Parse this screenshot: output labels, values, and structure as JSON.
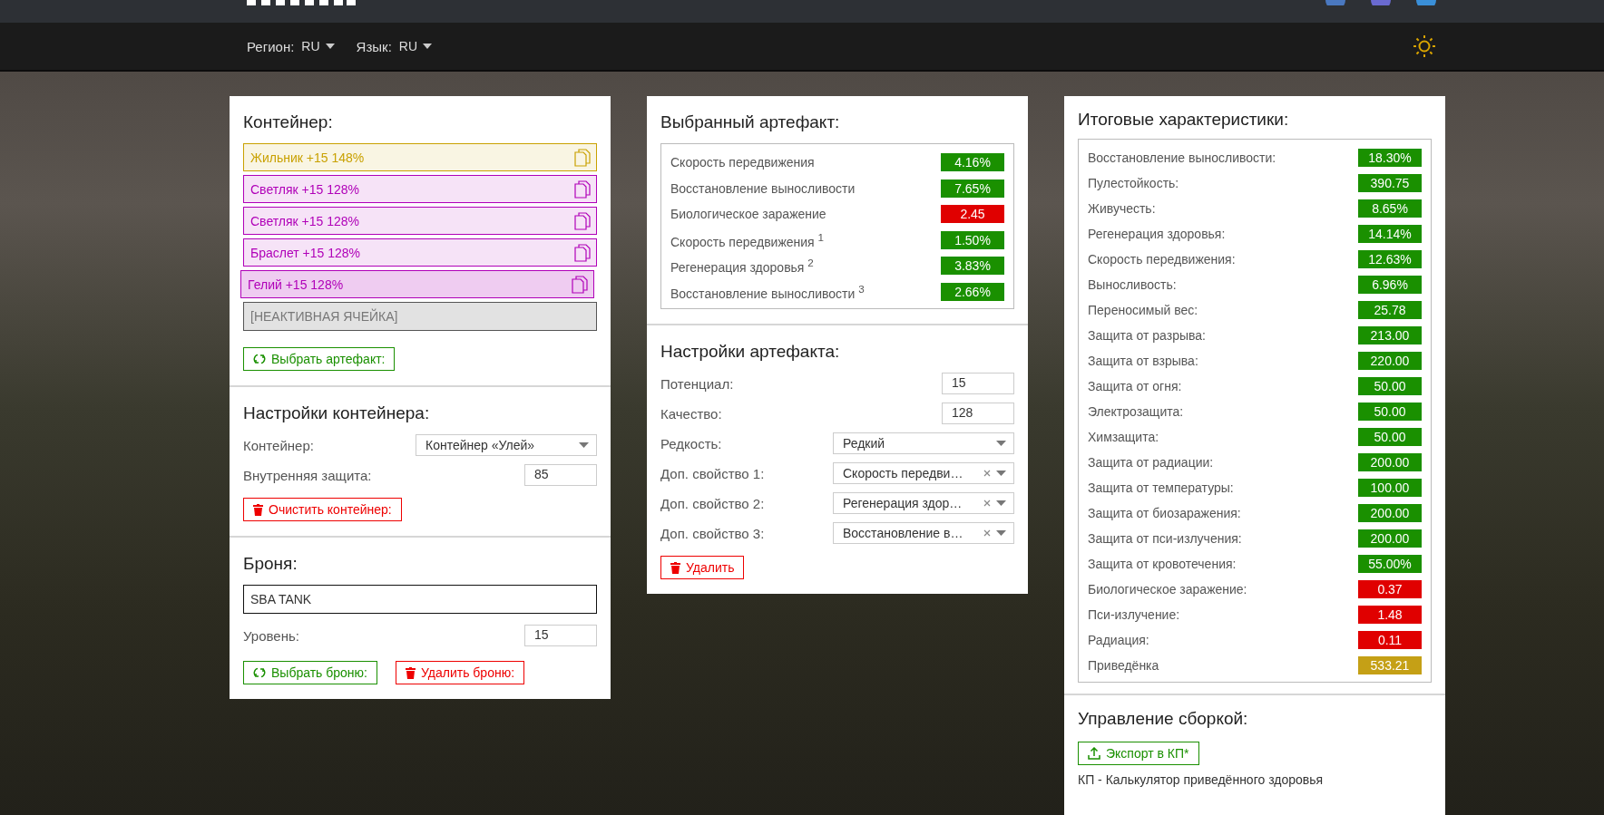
{
  "nav": {
    "region": {
      "label": "Регион:",
      "value": "RU"
    },
    "language": {
      "label": "Язык:",
      "value": "RU"
    }
  },
  "container": {
    "title": "Контейнер:",
    "cells": [
      {
        "kind": "artifact",
        "label": "Жильник +15 148%",
        "color": "#c9a100",
        "selected": false
      },
      {
        "kind": "artifact",
        "label": "Светляк +15 128%",
        "color": "#b000b8",
        "selected": false
      },
      {
        "kind": "artifact",
        "label": "Светляк +15 128%",
        "color": "#b000b8",
        "selected": false
      },
      {
        "kind": "artifact",
        "label": "Браслет +15 128%",
        "color": "#b000b8",
        "selected": false
      },
      {
        "kind": "artifact",
        "label": "Гелий +15 128%",
        "color": "#b000b8",
        "selected": true
      },
      {
        "kind": "inactive",
        "label": "[НЕАКТИВНАЯ ЯЧЕЙКА]",
        "color": "#555555",
        "selected": false
      }
    ],
    "select_button": "Выбрать артефакт:"
  },
  "container_settings": {
    "title": "Настройки контейнера:",
    "fields": [
      {
        "kind": "select",
        "label": "Контейнер:",
        "value": "Контейнер «Улей»",
        "clearable": false
      },
      {
        "kind": "input",
        "label": "Внутренняя защита:",
        "value": "85"
      }
    ],
    "clear_button": "Очистить контейнер:"
  },
  "armor": {
    "title": "Броня:",
    "name": "SBA TANK",
    "fields": [
      {
        "kind": "input",
        "label": "Уровень:",
        "value": "15"
      }
    ],
    "select_button": "Выбрать броню:",
    "delete_button": "Удалить броню:"
  },
  "selected_artifact": {
    "title": "Выбранный артефакт:",
    "stats": [
      {
        "label": "Скорость передвижения",
        "value": "4.16%",
        "color": "#1a9000"
      },
      {
        "label": "Восстановление выносливости",
        "value": "7.65%",
        "color": "#1a9000"
      },
      {
        "label": "Биологическое заражение",
        "value": "2.45",
        "color": "#e00000"
      },
      {
        "label": "Скорость передвижения $^{1}$",
        "value": "1.50%",
        "color": "#1a9000"
      },
      {
        "label": "Регенерация здоровья $^{2}$",
        "value": "3.83%",
        "color": "#1a9000"
      },
      {
        "label": "Восстановление выносливости $^{3}$",
        "value": "2.66%",
        "color": "#1a9000"
      }
    ]
  },
  "artifact_settings": {
    "title": "Настройки артефакта:",
    "fields": [
      {
        "kind": "input",
        "label": "Потенциал:",
        "value": "15"
      },
      {
        "kind": "input",
        "label": "Качество:",
        "value": "128"
      },
      {
        "kind": "select",
        "label": "Редкость:",
        "value": "Редкий",
        "clearable": false
      },
      {
        "kind": "select",
        "label": "Доп. свойство 1:",
        "value": "Скорость передви…",
        "clearable": true
      },
      {
        "kind": "select",
        "label": "Доп. свойство 2:",
        "value": "Регенерация здор…",
        "clearable": true
      },
      {
        "kind": "select",
        "label": "Доп. свойство 3:",
        "value": "Восстановление в…",
        "clearable": true
      }
    ],
    "delete_button": "Удалить"
  },
  "totals": {
    "title": "Итоговые характеристики:",
    "stats": [
      {
        "label": "Восстановление выносливости:",
        "value": "18.30%",
        "color": "#1a9000"
      },
      {
        "label": "Пулестойкость:",
        "value": "390.75",
        "color": "#1a9000"
      },
      {
        "label": "Живучесть:",
        "value": "8.65%",
        "color": "#1a9000"
      },
      {
        "label": "Регенерация здоровья:",
        "value": "14.14%",
        "color": "#1a9000"
      },
      {
        "label": "Скорость передвижения:",
        "value": "12.63%",
        "color": "#1a9000"
      },
      {
        "label": "Выносливость:",
        "value": "6.96%",
        "color": "#1a9000"
      },
      {
        "label": "Переносимый вес:",
        "value": "25.78",
        "color": "#1a9000"
      },
      {
        "label": "Защита от разрыва:",
        "value": "213.00",
        "color": "#1a9000"
      },
      {
        "label": "Защита от взрыва:",
        "value": "220.00",
        "color": "#1a9000"
      },
      {
        "label": "Защита от огня:",
        "value": "50.00",
        "color": "#1a9000"
      },
      {
        "label": "Электрозащита:",
        "value": "50.00",
        "color": "#1a9000"
      },
      {
        "label": "Химзащита:",
        "value": "50.00",
        "color": "#1a9000"
      },
      {
        "label": "Защита от радиации:",
        "value": "200.00",
        "color": "#1a9000"
      },
      {
        "label": "Защита от температуры:",
        "value": "100.00",
        "color": "#1a9000"
      },
      {
        "label": "Защита от биозаражения:",
        "value": "200.00",
        "color": "#1a9000"
      },
      {
        "label": "Защита от пси-излучения:",
        "value": "200.00",
        "color": "#1a9000"
      },
      {
        "label": "Защита от кровотечения:",
        "value": "55.00%",
        "color": "#1a9000"
      },
      {
        "label": "Биологическое заражение:",
        "value": "0.37",
        "color": "#e00000"
      },
      {
        "label": "Пси-излучение:",
        "value": "1.48",
        "color": "#e00000"
      },
      {
        "label": "Радиация:",
        "value": "0.11",
        "color": "#e00000"
      },
      {
        "label": "Приведёнка",
        "value": "533.21",
        "color": "#c5a016"
      }
    ]
  },
  "build": {
    "title": "Управление сборкой:",
    "export_button": "Экспорт в КП*",
    "note": "КП - Калькулятор приведённого здоровья"
  }
}
